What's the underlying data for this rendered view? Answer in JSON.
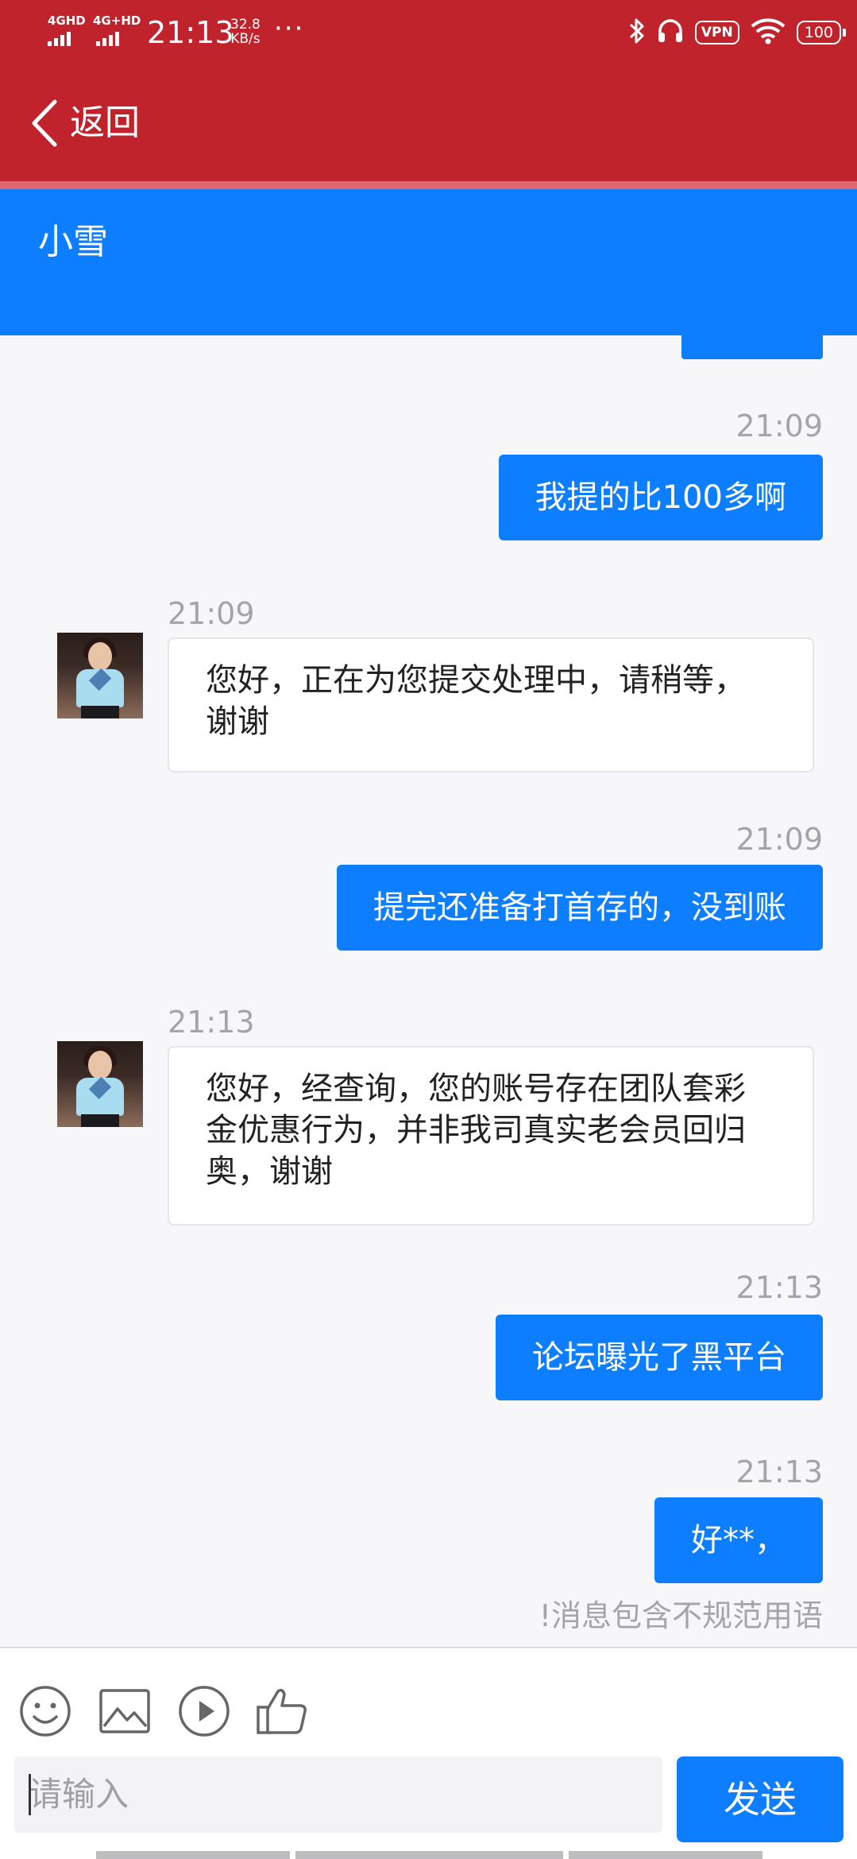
{
  "status_bar": {
    "signal1": "4GHD",
    "signal2": "4G+HD",
    "time": "21:13",
    "speed_value": "32.8",
    "speed_unit": "KB/s",
    "more": "···",
    "vpn": "VPN",
    "battery": "100"
  },
  "header": {
    "back_label": "返回"
  },
  "contact": {
    "name": "小雪"
  },
  "messages": [
    {
      "side": "out",
      "time": "21:09",
      "text": "我提的比100多啊"
    },
    {
      "side": "in",
      "time": "21:09",
      "text": "您好，正在为您提交处理中，请稍等，谢谢"
    },
    {
      "side": "out",
      "time": "21:09",
      "text": "提完还准备打首存的，没到账"
    },
    {
      "side": "in",
      "time": "21:13",
      "text": "您好，经查询，您的账号存在团队套彩金优惠行为，并非我司真实老会员回归奥，谢谢"
    },
    {
      "side": "out",
      "time": "21:13",
      "text": "论坛曝光了黑平台"
    },
    {
      "side": "out",
      "time": "21:13",
      "text": "好**，"
    }
  ],
  "warning": "!消息包含不规范用语",
  "input": {
    "placeholder": "请输入"
  },
  "send_label": "发送",
  "icons": [
    "chevron-left-icon",
    "bluetooth-icon",
    "headphones-icon",
    "wifi-icon",
    "emoji-icon",
    "image-icon",
    "play-icon",
    "thumbs-up-icon"
  ],
  "colors": {
    "header_red": "#c1232c",
    "accent_blue": "#0d7eff",
    "chat_bg": "#f7f7f9"
  }
}
